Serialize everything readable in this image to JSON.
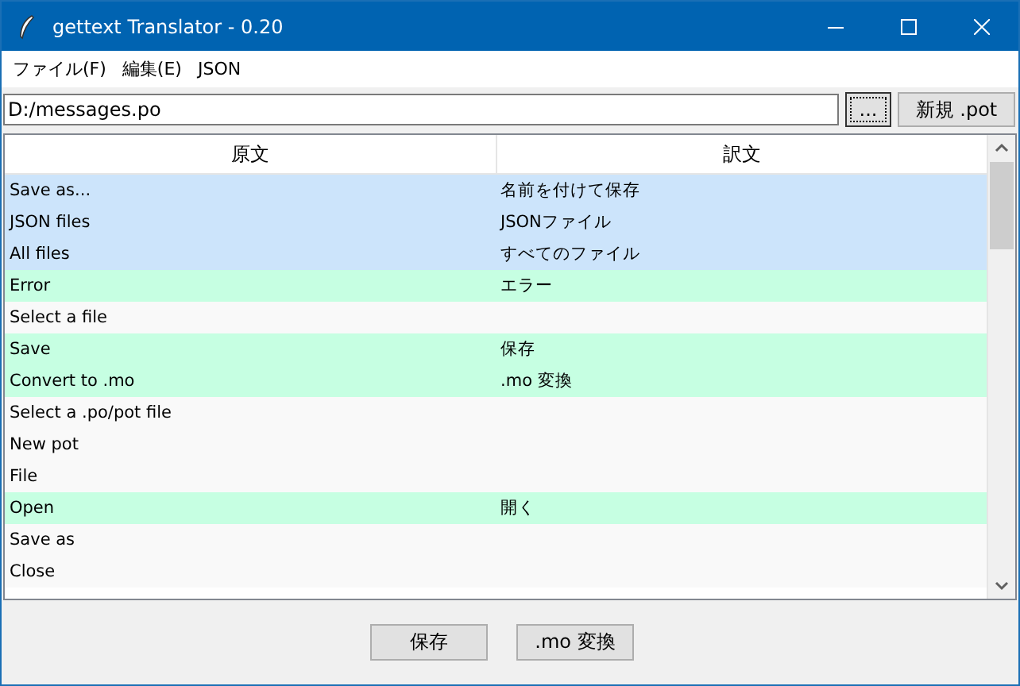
{
  "window": {
    "title": "gettext Translator - 0.20"
  },
  "menu": [
    {
      "label": "ファイル(F)"
    },
    {
      "label": "編集(E)"
    },
    {
      "label": "JSON"
    }
  ],
  "path_field": {
    "value": "D:/messages.po"
  },
  "toolbar_buttons": [
    {
      "label": "...",
      "kind": "focused"
    },
    {
      "label": "新規 .pot",
      "kind": "plain"
    }
  ],
  "table": {
    "columns": [
      "原文",
      "訳文"
    ],
    "rows": [
      {
        "source": "Save as...",
        "translation": "名前を付けて保存",
        "selected": true
      },
      {
        "source": "JSON files",
        "translation": "JSONファイル",
        "selected": true
      },
      {
        "source": "All files",
        "translation": "すべてのファイル",
        "selected": true
      },
      {
        "source": "Error",
        "translation": "エラー",
        "selected": false,
        "translated": true
      },
      {
        "source": "Select a file",
        "selected": false,
        "translated": false
      },
      {
        "source": "Save",
        "translation": "保存",
        "selected": false,
        "translated": true
      },
      {
        "source": "Convert to .mo",
        "translation": ".mo 変換",
        "selected": false,
        "translated": true
      },
      {
        "source": "Select a .po/pot file",
        "selected": false,
        "translated": false
      },
      {
        "source": "New pot",
        "selected": false,
        "translated": false
      },
      {
        "source": "File",
        "selected": false,
        "translated": false
      },
      {
        "source": "Open",
        "translation": "開く",
        "selected": false,
        "translated": true
      },
      {
        "source": "Save as",
        "selected": false,
        "translated": false
      },
      {
        "source": "Close",
        "selected": false,
        "translated": false
      }
    ]
  },
  "buttons": [
    {
      "label": "保存"
    },
    {
      "label": ".mo 変換"
    }
  ]
}
